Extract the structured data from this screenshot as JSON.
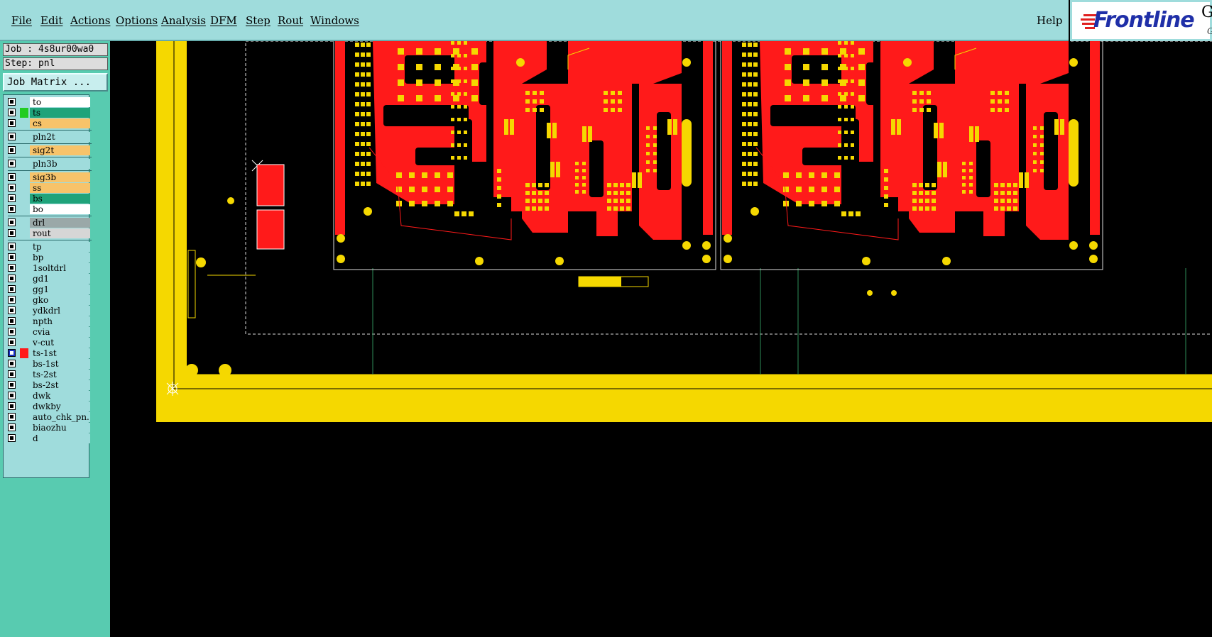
{
  "menubar": {
    "items": [
      "File",
      "Edit",
      "Actions",
      "Options",
      "Analysis",
      "DFM",
      "Step",
      "Rout",
      "Windows"
    ],
    "help_label": "Help"
  },
  "logo": {
    "text": "Frontline",
    "suffix": "Ge",
    "suffix2": "G"
  },
  "job": {
    "label": "Job : 4s8ur00wa0",
    "step": "Step: pnl",
    "matrix_button": "Job Matrix ..."
  },
  "layers": [
    {
      "name": "to",
      "color": "#ffffff",
      "active": false
    },
    {
      "name": "ts",
      "color": "#1fa37a",
      "active": false,
      "swatch": "#22cc22"
    },
    {
      "name": "cs",
      "color": "#f7c36a",
      "active": false
    },
    {
      "name": "pln2t",
      "color": "#9fdcdc",
      "active": false
    },
    {
      "name": "sig2t",
      "color": "#f7c36a",
      "active": false
    },
    {
      "name": "pln3b",
      "color": "#9fdcdc",
      "active": false
    },
    {
      "name": "sig3b",
      "color": "#f7c36a",
      "active": false
    },
    {
      "name": "ss",
      "color": "#f7c36a",
      "active": false
    },
    {
      "name": "bs",
      "color": "#1fa37a",
      "active": false
    },
    {
      "name": "bo",
      "color": "#ffffff",
      "active": false
    },
    {
      "name": "drl",
      "color": "#9aa8a8",
      "active": false
    },
    {
      "name": "rout",
      "color": "#d6d6d6",
      "active": false
    },
    {
      "name": "tp",
      "color": "#9fdcdc",
      "active": false
    },
    {
      "name": "bp",
      "color": "#9fdcdc",
      "active": false
    },
    {
      "name": "1soltdrl",
      "color": "#9fdcdc",
      "active": false
    },
    {
      "name": "gd1",
      "color": "#9fdcdc",
      "active": false
    },
    {
      "name": "gg1",
      "color": "#9fdcdc",
      "active": false
    },
    {
      "name": "gko",
      "color": "#9fdcdc",
      "active": false
    },
    {
      "name": "ydkdrl",
      "color": "#9fdcdc",
      "active": false
    },
    {
      "name": "npth",
      "color": "#9fdcdc",
      "active": false
    },
    {
      "name": "cvia",
      "color": "#9fdcdc",
      "active": false
    },
    {
      "name": "v-cut",
      "color": "#9fdcdc",
      "active": false
    },
    {
      "name": "ts-1st",
      "color": "#9fdcdc",
      "active": true,
      "swatch": "#ff1a1a"
    },
    {
      "name": "bs-1st",
      "color": "#9fdcdc",
      "active": false
    },
    {
      "name": "ts-2st",
      "color": "#9fdcdc",
      "active": false
    },
    {
      "name": "bs-2st",
      "color": "#9fdcdc",
      "active": false
    },
    {
      "name": "dwk",
      "color": "#9fdcdc",
      "active": false
    },
    {
      "name": "dwkby",
      "color": "#9fdcdc",
      "active": false
    },
    {
      "name": "auto_chk_pn.",
      "color": "#9fdcdc",
      "active": false
    },
    {
      "name": "biaozhu",
      "color": "#9fdcdc",
      "active": false
    },
    {
      "name": "d",
      "color": "#9fdcdc",
      "active": false
    }
  ],
  "colors": {
    "board_red": "#ff1a1a",
    "copper_yellow": "#f5d800",
    "panel_bg": "#58cbb0",
    "menubar": "#9fdcdc"
  }
}
